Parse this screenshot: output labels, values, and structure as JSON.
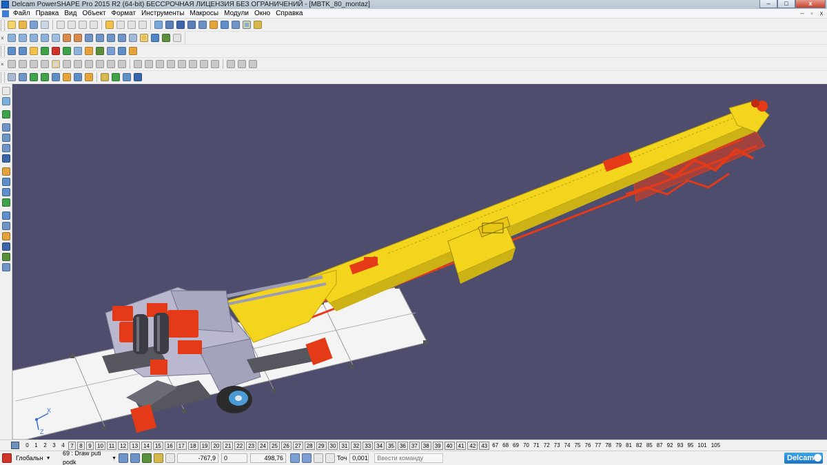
{
  "window": {
    "title": "Delcam PowerSHAPE Pro 2015 R2 (64-bit) БЕССРОЧНАЯ ЛИЦЕНЗИЯ БЕЗ ОГРАНИЧЕНИЙ - [MBTK_80_montaz]",
    "minimize": "–",
    "maximize": "□",
    "close": "x"
  },
  "menu": {
    "items": [
      "Файл",
      "Правка",
      "Вид",
      "Объект",
      "Формат",
      "Инструменты",
      "Макросы",
      "Модули",
      "Окно",
      "Справка"
    ],
    "mdi_minimize": "–",
    "mdi_restore": "▫",
    "mdi_close": "x"
  },
  "toolbars": {
    "close_glyph": "×"
  },
  "viewport": {
    "background": "#4e4d6d",
    "axes": {
      "x": "X",
      "z": "Z"
    }
  },
  "levels": {
    "items": [
      "0",
      "1",
      "2",
      "3",
      "4",
      "7",
      "8",
      "9",
      "10",
      "11",
      "12",
      "13",
      "14",
      "15",
      "16",
      "17",
      "18",
      "19",
      "20",
      "21",
      "22",
      "23",
      "24",
      "25",
      "26",
      "27",
      "28",
      "29",
      "30",
      "31",
      "32",
      "33",
      "34",
      "35",
      "36",
      "37",
      "38",
      "39",
      "40",
      "41",
      "42",
      "43",
      "67",
      "68",
      "69",
      "70",
      "71",
      "72",
      "73",
      "74",
      "75",
      "76",
      "77",
      "78",
      "79",
      "81",
      "82",
      "85",
      "87",
      "92",
      "93",
      "95",
      "101",
      "105"
    ],
    "highlighted": [
      "7",
      "8",
      "9",
      "10",
      "11",
      "12",
      "13",
      "14",
      "15",
      "16",
      "17",
      "18",
      "19",
      "20",
      "21",
      "22",
      "23",
      "24",
      "25",
      "26",
      "27",
      "28",
      "29",
      "30",
      "31",
      "32",
      "33",
      "34",
      "35",
      "36",
      "37",
      "38",
      "39",
      "40",
      "41",
      "42",
      "43"
    ]
  },
  "status": {
    "workplane": "Глобальн",
    "level_select": "69 : Draw puti podk",
    "x": "-767,9",
    "y": "0",
    "z": "498,76",
    "tolerance_label": "Точ",
    "tolerance_value": "0,001",
    "command_placeholder": "Ввести команду",
    "logo": "Delcam"
  },
  "colors": {
    "boom_yellow": "#f2d51c",
    "boom_yellow_shade": "#cdb216",
    "red_parts": "#e53a17",
    "grey_frame": "#b9b8cf",
    "dark_grey": "#55565e",
    "platform": "#f4f4f4"
  }
}
